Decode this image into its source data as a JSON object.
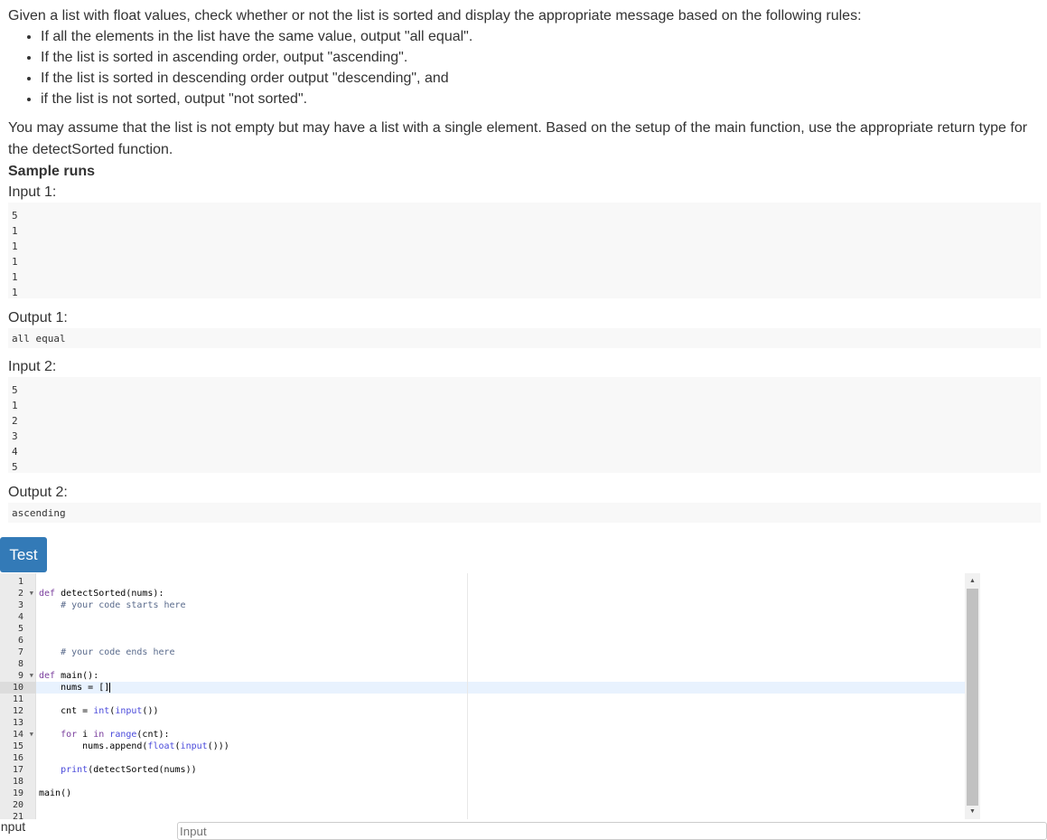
{
  "problem": {
    "intro": "Given a list with float values, check whether or not the list is sorted and display the appropriate message based on the following rules:",
    "rules": [
      "If all the elements in the list have the same value, output \"all equal\".",
      "If the list is sorted in ascending order, output \"ascending\".",
      "If the list is sorted in descending order output \"descending\", and",
      "if the list is not sorted, output \"not sorted\"."
    ],
    "assumption": "You may assume that the list is not empty but may have a list with a single element. Based on the setup of the main function, use the appropriate return type for the detectSorted function.",
    "sample_title": "Sample runs",
    "samples": [
      {
        "input_label": "Input 1:",
        "input_lines": [
          "5",
          "1",
          "1",
          "1",
          "1",
          "1"
        ],
        "output_label": "Output 1:",
        "output_lines": [
          "all equal"
        ]
      },
      {
        "input_label": "Input 2:",
        "input_lines": [
          "5",
          "1",
          "2",
          "3",
          "4",
          "5"
        ],
        "output_label": "Output 2:",
        "output_lines": [
          "ascending"
        ]
      }
    ]
  },
  "test_button": "Test",
  "editor": {
    "active_line": 10,
    "lines": [
      {
        "n": "1",
        "fold": false
      },
      {
        "n": "2",
        "fold": true
      },
      {
        "n": "3",
        "fold": false
      },
      {
        "n": "4",
        "fold": false
      },
      {
        "n": "5",
        "fold": false
      },
      {
        "n": "6",
        "fold": false
      },
      {
        "n": "7",
        "fold": false
      },
      {
        "n": "8",
        "fold": false
      },
      {
        "n": "9",
        "fold": true
      },
      {
        "n": "10",
        "fold": false
      },
      {
        "n": "11",
        "fold": false
      },
      {
        "n": "12",
        "fold": false
      },
      {
        "n": "13",
        "fold": false
      },
      {
        "n": "14",
        "fold": true
      },
      {
        "n": "15",
        "fold": false
      },
      {
        "n": "16",
        "fold": false
      },
      {
        "n": "17",
        "fold": false
      },
      {
        "n": "18",
        "fold": false
      },
      {
        "n": "19",
        "fold": false
      },
      {
        "n": "20",
        "fold": false
      },
      {
        "n": "21",
        "fold": false
      }
    ],
    "code": [
      "",
      "def detectSorted(nums):",
      "    # your code starts here",
      "",
      "",
      "",
      "    # your code ends here    ",
      "",
      "def main():",
      "    nums = []",
      "    ",
      "    cnt = int(input())",
      "    ",
      "    for i in range(cnt):",
      "        nums.append(float(input()))",
      "        ",
      "    print(detectSorted(nums))",
      "",
      "main()",
      "",
      ""
    ]
  },
  "input_label": "Input",
  "input_placeholder": "Input"
}
